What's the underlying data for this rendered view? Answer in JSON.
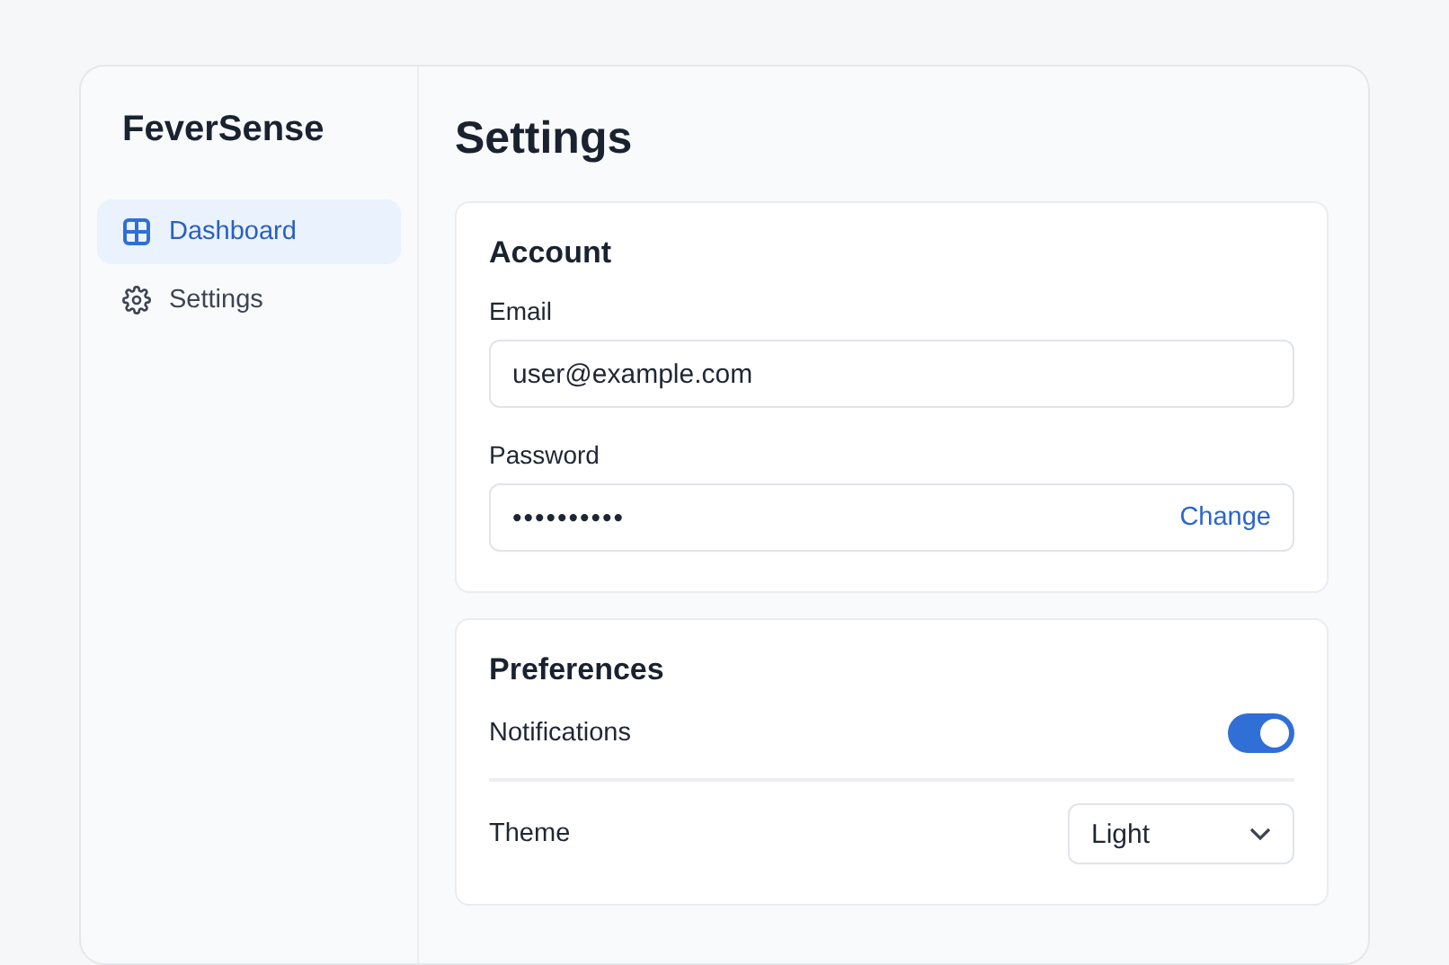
{
  "sidebar": {
    "brand": "FeverSense",
    "items": [
      {
        "label": "Dashboard",
        "kind": "grid",
        "selected": true
      },
      {
        "label": "Settings",
        "kind": "gear",
        "selected": false
      }
    ]
  },
  "page_title": "Settings",
  "account": {
    "title": "Account",
    "fields": [
      {
        "label": "Email",
        "kind": "text",
        "value": "user@example.com"
      },
      {
        "label": "Password",
        "kind": "password",
        "value": "••••••••••",
        "action": "Change"
      }
    ]
  },
  "preferences": {
    "title": "Preferences",
    "rows": [
      {
        "label": "Notifications",
        "kind": "toggle",
        "on": true
      },
      {
        "label": "Theme",
        "kind": "select",
        "value": "Light"
      }
    ]
  }
}
